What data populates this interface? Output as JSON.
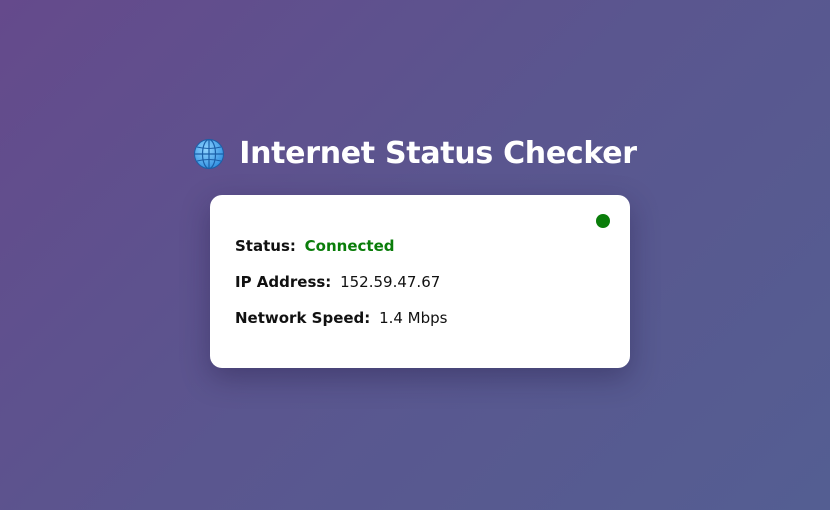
{
  "header": {
    "title": "Internet Status Checker",
    "icon": "globe-icon"
  },
  "status_card": {
    "indicator_color": "#0a7d0a",
    "indicator_state": "online",
    "status": {
      "label": "Status:",
      "value": "Connected",
      "color": "#0a7d0a"
    },
    "ip": {
      "label": "IP Address:",
      "value": "152.59.47.67"
    },
    "speed": {
      "label": "Network Speed:",
      "value": "1.4 Mbps"
    }
  }
}
